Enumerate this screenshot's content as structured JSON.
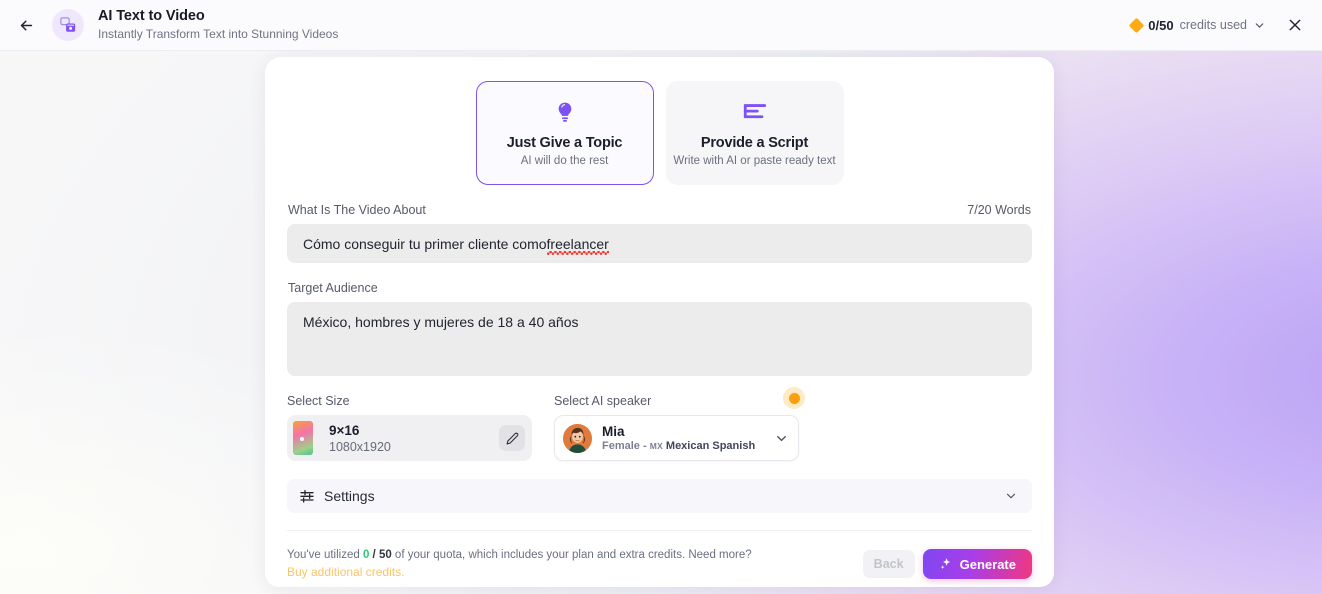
{
  "header": {
    "back_icon": "arrow-left-icon",
    "app_icon": "video-app-icon",
    "title": "AI Text to Video",
    "subtitle": "Instantly Transform Text into Stunning Videos",
    "credits": {
      "icon": "diamond-icon",
      "value": "0/50",
      "label": "credits used",
      "chevron": "chevron-down-icon"
    },
    "close_icon": "close-icon"
  },
  "modes": [
    {
      "icon": "lightbulb-icon",
      "title": "Just Give a Topic",
      "subtitle": "AI will do the rest",
      "active": true
    },
    {
      "icon": "script-lines-icon",
      "title": "Provide a Script",
      "subtitle": "Write with AI or paste ready text",
      "active": false
    }
  ],
  "topic_field": {
    "label": "What Is The Video About",
    "counter": "7/20 Words",
    "value_head": "Cómo conseguir tu primer cliente como ",
    "value_misspelled": "freelancer"
  },
  "audience_field": {
    "label": "Target Audience",
    "value": "México, hombres y mujeres de 18 a 40 años"
  },
  "size": {
    "label": "Select Size",
    "ratio": "9×16",
    "resolution": "1080x1920",
    "edit_icon": "pencil-icon"
  },
  "speaker": {
    "label": "Select AI speaker",
    "name": "Mia",
    "gender": "Female - ",
    "country_code": "MX",
    "language": "Mexican Spanish",
    "chevron": "chevron-down-icon",
    "badge": "premium-badge",
    "avatar": "speaker-avatar"
  },
  "settings": {
    "icon": "sliders-icon",
    "label": "Settings",
    "chevron": "chevron-down-icon"
  },
  "footer": {
    "quota_prefix": "You've utilized ",
    "quota_used": "0",
    "quota_sep": " / ",
    "quota_total": "50",
    "quota_suffix": " of your quota, which includes your plan and extra credits. Need more?",
    "buy_link": "Buy additional credits.",
    "back_label": "Back",
    "generate_label": "Generate",
    "generate_icon": "sparkle-icon"
  },
  "colors": {
    "accent_purple": "#7c52f4",
    "accent_pink": "#f0377f",
    "credit_gold": "#fbab17",
    "quota_green": "#2fc76c",
    "buy_link": "#fac469"
  }
}
